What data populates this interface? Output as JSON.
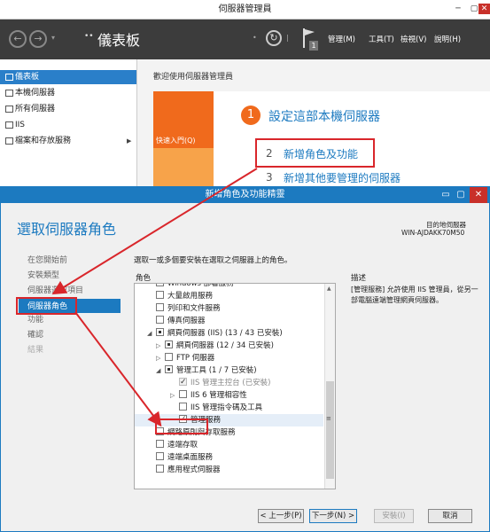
{
  "server_manager": {
    "title": "伺服器管理員",
    "breadcrumb_arrow": "••",
    "breadcrumb": "儀表板",
    "menus": [
      "管理(M)",
      "工具(T)",
      "檢視(V)",
      "說明(H)"
    ],
    "notification_count": "1",
    "sidebar": [
      {
        "label": "儀表板",
        "icon": "dashboard-icon",
        "selected": true
      },
      {
        "label": "本機伺服器",
        "icon": "server-icon"
      },
      {
        "label": "所有伺服器",
        "icon": "servers-icon"
      },
      {
        "label": "IIS",
        "icon": "iis-icon"
      },
      {
        "label": "檔案和存放服務",
        "icon": "storage-icon",
        "has_arrow": true
      }
    ],
    "welcome": "歡迎使用伺服器管理員",
    "quickstart_label": "快速入門(Q)",
    "steps": [
      {
        "num": "1",
        "label": "設定這部本機伺服器"
      },
      {
        "num": "2",
        "label": "新增角色及功能"
      },
      {
        "num": "3",
        "label": "新增其他要管理的伺服器"
      }
    ]
  },
  "wizard": {
    "title": "新增角色及功能精靈",
    "heading": "選取伺服器角色",
    "dest_label": "目的地伺服器",
    "dest_server": "WIN-AJDAKK70M50",
    "nav": [
      {
        "label": "在您開始前",
        "state": "normal"
      },
      {
        "label": "安裝類型",
        "state": "normal"
      },
      {
        "label": "伺服器選取項目",
        "state": "normal"
      },
      {
        "label": "伺服器角色",
        "state": "selected"
      },
      {
        "label": "功能",
        "state": "normal"
      },
      {
        "label": "確認",
        "state": "normal"
      },
      {
        "label": "結果",
        "state": "disabled"
      }
    ],
    "instruction": "選取一或多個要安裝在選取之伺服器上的角色。",
    "roles_header": "角色",
    "desc_header": "描述",
    "description": "[管理服務] 允許使用 IIS 管理員，從另一部電腦遠端管理網頁伺服器。",
    "roles": [
      {
        "label": "Windows 部署服務",
        "level": 0,
        "check": "none",
        "expander": ""
      },
      {
        "label": "大量啟用服務",
        "level": 0,
        "check": "none",
        "expander": ""
      },
      {
        "label": "列印和文件服務",
        "level": 0,
        "check": "none",
        "expander": ""
      },
      {
        "label": "傳真伺服器",
        "level": 0,
        "check": "none",
        "expander": ""
      },
      {
        "label": "網頁伺服器 (IIS) (13 / 43 已安裝)",
        "level": 0,
        "check": "partial",
        "expander": "◢"
      },
      {
        "label": "網頁伺服器 (12 / 34 已安裝)",
        "level": 1,
        "check": "partial",
        "expander": "▷"
      },
      {
        "label": "FTP 伺服器",
        "level": 1,
        "check": "none",
        "expander": "▷"
      },
      {
        "label": "管理工具 (1 / 7 已安裝)",
        "level": 1,
        "check": "partial",
        "expander": "◢"
      },
      {
        "label": "IIS 管理主控台 (已安裝)",
        "level": 2,
        "check": "checked-disabled",
        "expander": ""
      },
      {
        "label": "IIS 6 管理相容性",
        "level": 2,
        "check": "none",
        "expander": "▷"
      },
      {
        "label": "IIS 管理指令碼及工具",
        "level": 2,
        "check": "none",
        "expander": ""
      },
      {
        "label": "管理服務",
        "level": 2,
        "check": "checked",
        "expander": "",
        "highlight": true
      },
      {
        "label": "網路原則與存取服務",
        "level": 0,
        "check": "none",
        "expander": ""
      },
      {
        "label": "遠端存取",
        "level": 0,
        "check": "none",
        "expander": ""
      },
      {
        "label": "遠端桌面服務",
        "level": 0,
        "check": "none",
        "expander": ""
      },
      {
        "label": "應用程式伺服器",
        "level": 0,
        "check": "none",
        "expander": ""
      }
    ],
    "buttons": {
      "prev": "< 上一步(P)",
      "next": "下一步(N) >",
      "install": "安裝(I)",
      "cancel": "取消"
    },
    "win_controls": [
      "▭",
      "▢",
      "✕"
    ]
  },
  "colors": {
    "accent": "#1c7ac0",
    "highlight": "#d9262b",
    "tile_orange": "#f06a1c"
  }
}
